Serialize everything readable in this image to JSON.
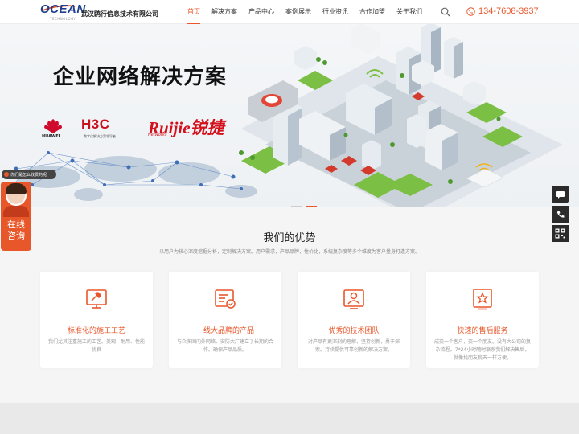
{
  "brand": {
    "logo_word": "OCEAN",
    "logo_sub": "TECHNOLOGY",
    "company_name": "武汉鸥行信息技术有限公司"
  },
  "nav": {
    "items": [
      {
        "label": "首页",
        "active": true
      },
      {
        "label": "解决方案",
        "active": false
      },
      {
        "label": "产品中心",
        "active": false
      },
      {
        "label": "案例展示",
        "active": false
      },
      {
        "label": "行业资讯",
        "active": false
      },
      {
        "label": "合作加盟",
        "active": false
      },
      {
        "label": "关于我们",
        "active": false
      }
    ],
    "phone": "134-7608-3937"
  },
  "banner": {
    "title": "企业网络解决方案",
    "brands": {
      "huawei": "HUAWEI",
      "h3c": "H3C",
      "h3c_sub": "数字化解决方案领导者",
      "ruijie": "Ruijie锐捷",
      "ruijie_sub": "Networks"
    }
  },
  "chat": {
    "bubble": "你们是怎么收费的呢",
    "label_line1": "在线",
    "label_line2": "咨询"
  },
  "advantages": {
    "title": "我们的优势",
    "subtitle": "以用户为核心深度挖掘分析，定制解决方案。用户需求，产品品牌，性价比，系统复杂度等多个维度为客户量身打造方案。",
    "cards": [
      {
        "icon": "tools-icon",
        "title": "标准化的施工工艺",
        "desc": "我们尤其注重施工的工艺。美观、耐用、性能优良"
      },
      {
        "icon": "brand-list-icon",
        "title": "一线大品牌的产品",
        "desc": "与众多国内外网络、安防大厂建立了长期的合作。确保产品品质。"
      },
      {
        "icon": "team-icon",
        "title": "优秀的技术团队",
        "desc": "对产品有更深刻的理解，坚持创新，勇于探索。持续提供可靠创新的解决方案。"
      },
      {
        "icon": "service-star-icon",
        "title": "快速的售后服务",
        "desc": "成交一个客户，交一个朋友。没有大公司的复杂流程。7*24小时随时联系我们解决售后，就像找朋友聊天一样方便。"
      }
    ]
  },
  "colors": {
    "accent": "#e8572a",
    "dark": "#2b2b2b"
  }
}
